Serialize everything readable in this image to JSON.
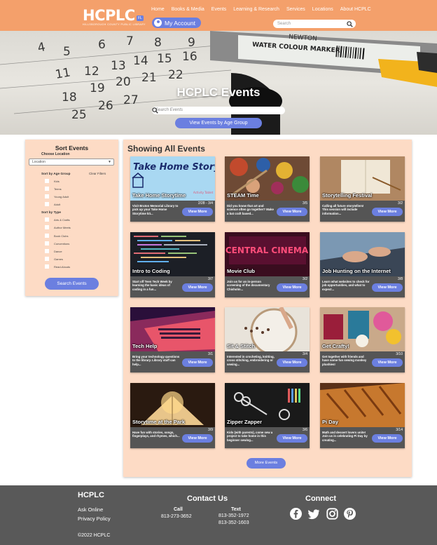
{
  "nav": {
    "logo": "HCPLC",
    "logo_tag": "FL",
    "logo_sub": "HILLSBOROUGH COUNTY PUBLIC LIBRARY",
    "links": [
      "Home",
      "Books & Media",
      "Events",
      "Learning & Research",
      "Services",
      "Locations",
      "About HCPLC"
    ],
    "account": "My Account",
    "search_placeholder": "Search"
  },
  "hero": {
    "title": "HCPLC Events",
    "search_placeholder": "Search Events",
    "button": "View Events by Age Group"
  },
  "sidebar": {
    "title": "Sort Events",
    "location_label": "Choose Location",
    "location_value": "Location",
    "age_heading": "Sort by Age Group",
    "clear": "Clear Filters",
    "ages": [
      "Kids",
      "Teens",
      "Young Adult",
      "Adult"
    ],
    "type_heading": "Sort by Type",
    "types": [
      "Arts & Crafts",
      "Author Meets",
      "Book Clubs",
      "Conventions",
      "Dance",
      "Games",
      "Read-Alouds"
    ],
    "button": "Search Events"
  },
  "main": {
    "title": "Showing All Events",
    "view_more": "View More",
    "more_events": "More Events",
    "events": [
      {
        "title": "Take Home Storytime",
        "date": "2/28 - 3/4",
        "desc": "Visit Bruton Memorial Library to pick up your Take Home Storytime kit...",
        "img_text": "Take Home Storytime",
        "img_sub": "Activity Tablet"
      },
      {
        "title": "STEAM Time",
        "date": "3/5",
        "desc": "Did you know that art and science often go together? Make a bat craft based..."
      },
      {
        "title": "Storytelling Festival",
        "date": "3/2",
        "desc": "Calling all future storytellers! This session will include information..."
      },
      {
        "title": "Intro to Coding",
        "date": "3/7",
        "desc": "Start off Teen Tech Week by learning the basic ideas of coding in a fun..."
      },
      {
        "title": "Movie Club",
        "date": "3/2",
        "desc": "Join us for an in-person screening of the documentary Chisholm...",
        "img_text": "CENTRAL CINEMA"
      },
      {
        "title": "Job Hunting on the Internet",
        "date": "3/8",
        "desc": "Learn what websites to check for job opportunities, and what to expect..."
      },
      {
        "title": "Tech Help",
        "date": "3/1",
        "desc": "Bring your technology questions to the library. Library staff can help..."
      },
      {
        "title": "Sit & Stitch",
        "date": "3/4",
        "desc": "Interested in crocheting, knitting, cross stitching, embroidering or sewing..."
      },
      {
        "title": "Get Crafty!",
        "date": "3/10",
        "desc": "Get together with friends and have some fun sewing monkey plushies!"
      },
      {
        "title": "Storytime at the Park",
        "date": "3/9",
        "desc": "Have fun with stories, songs, fingerplays, and rhymes, which..."
      },
      {
        "title": "Zipper Zapper",
        "date": "3/6",
        "desc": "Kids (with parents), come sew a project to take home in this beginner sewing..."
      },
      {
        "title": "Pi Day",
        "date": "3/14",
        "desc": "Math and dessert lovers unite! Join us in celebrating Pi Day by creating..."
      }
    ]
  },
  "footer": {
    "brand": "HCPLC",
    "ask": "Ask Online",
    "privacy": "Privacy Policy",
    "copyright": "©2022 HCPLC",
    "contact": "Contact Us",
    "call_label": "Call",
    "call_num": "813-273-3652",
    "text_label": "Text",
    "text_num1": "813-352-1972",
    "text_num2": "813-352-1603",
    "connect": "Connect",
    "social": [
      "facebook-icon",
      "twitter-icon",
      "instagram-icon",
      "pinterest-icon"
    ]
  },
  "colors": {
    "nav": "#f4a06b",
    "accent": "#6b7fe0",
    "panel": "#fddbc5",
    "footer": "#595959"
  }
}
